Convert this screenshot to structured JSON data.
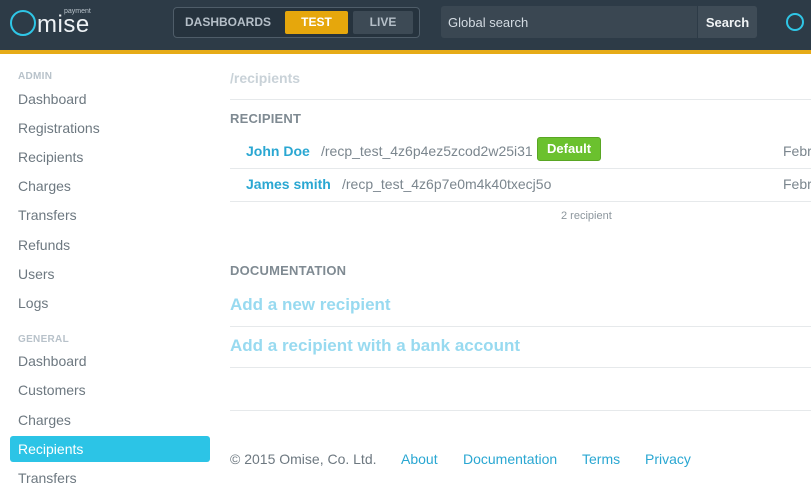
{
  "brand": {
    "logo_letter": "O",
    "logo_text": "mise",
    "logo_sub": "payment",
    "accent_color": "#e6ab18",
    "primary_color": "#2cc4e6"
  },
  "header": {
    "modes": [
      "DASHBOARDS",
      "TEST",
      "LIVE"
    ],
    "active_mode": "TEST",
    "search_placeholder": "Global search",
    "search_button": "Search",
    "user_icon": "circle-icon"
  },
  "sidebar": {
    "admin_heading": "ADMIN",
    "admin_items": [
      "Dashboard",
      "Registrations",
      "Recipients",
      "Charges",
      "Transfers",
      "Refunds",
      "Users",
      "Logs"
    ],
    "general_heading": "GENERAL",
    "general_items": [
      "Dashboard",
      "Customers",
      "Charges",
      "Recipients",
      "Transfers"
    ],
    "active_item": "Recipients"
  },
  "main": {
    "path": "/recipients",
    "recipient_heading": "RECIPIENT",
    "recipients": [
      {
        "name": "John Doe",
        "id": "/recp_test_4z6p4ez5zcod2w25i31",
        "badge": "Default",
        "date": "Febr"
      },
      {
        "name": "James smith",
        "id": "/recp_test_4z6p7e0m4k40txecj5o",
        "badge": "",
        "date": "Febr"
      }
    ],
    "count_text": "2 recipient",
    "documentation_heading": "DOCUMENTATION",
    "doc_links": [
      "Add a new recipient",
      "Add a recipient with a bank account"
    ]
  },
  "footer": {
    "copyright": "© 2015 Omise, Co. Ltd.",
    "links": [
      "About",
      "Documentation",
      "Terms",
      "Privacy"
    ]
  }
}
